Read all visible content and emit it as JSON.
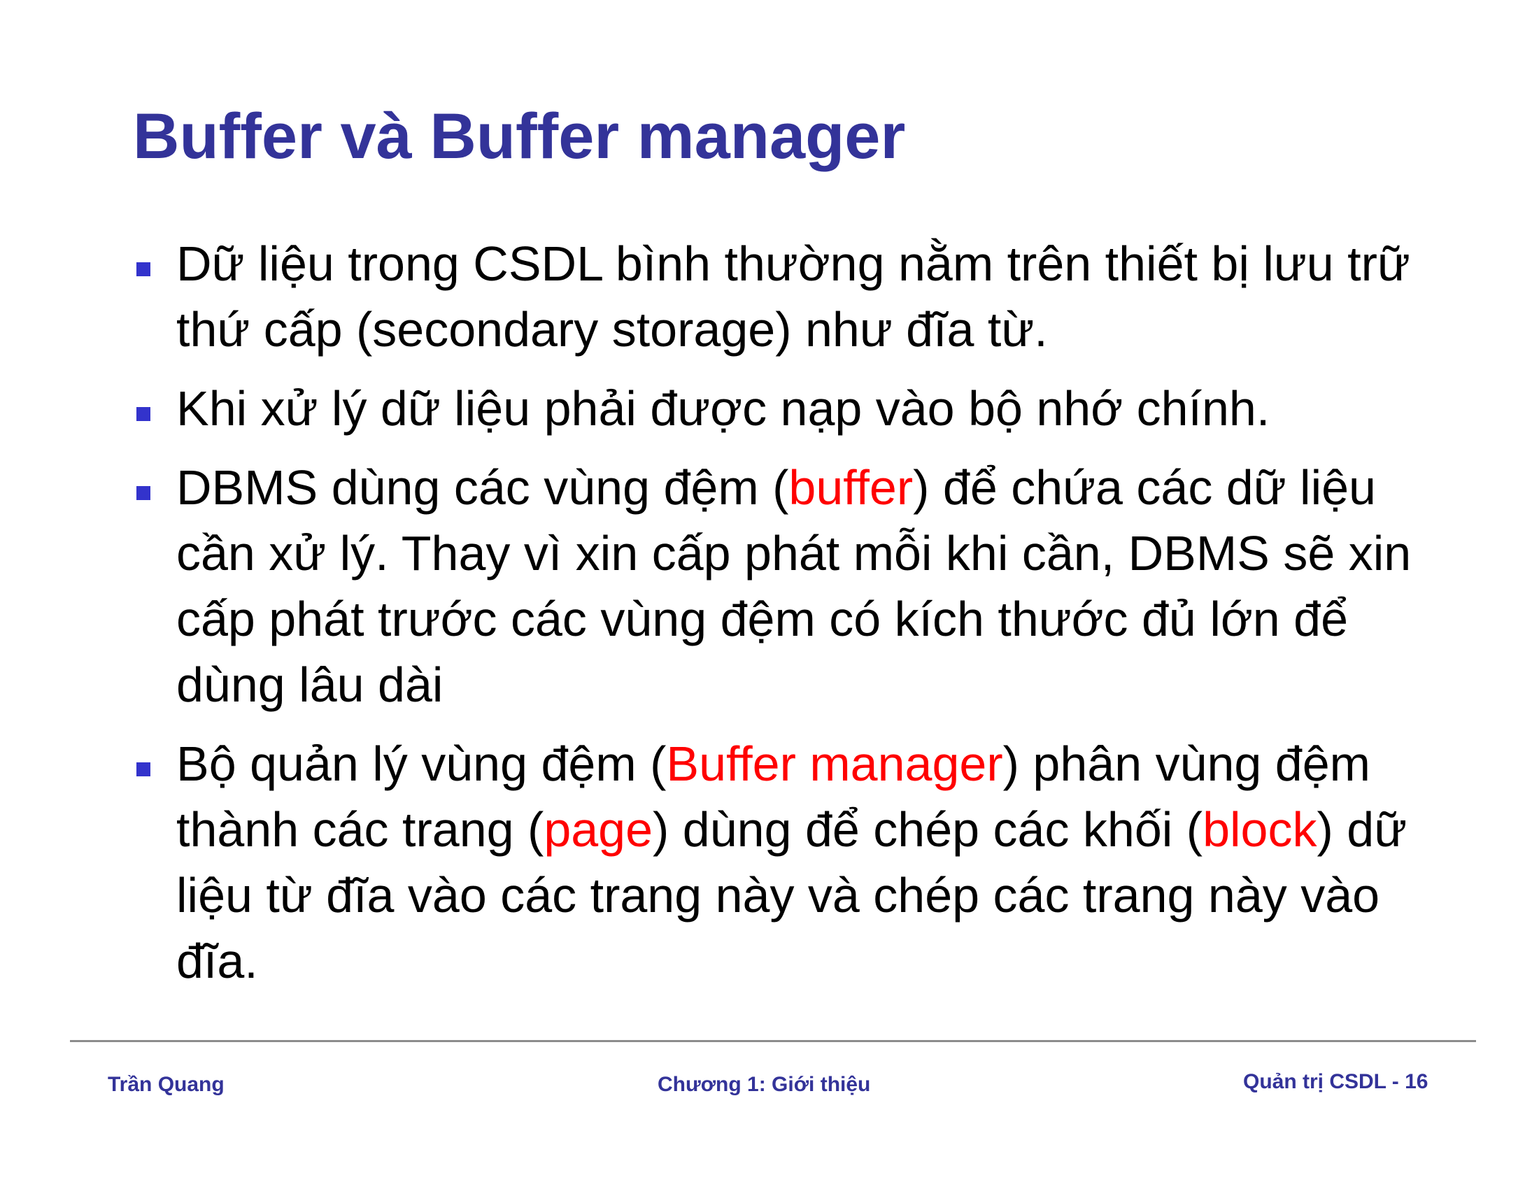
{
  "slide": {
    "title": "Buffer và Buffer manager",
    "accent_color": "#333399",
    "highlight_color": "#ff0000",
    "bullet_icon": "square-bullet-icon",
    "bullets": [
      {
        "segments": [
          {
            "text": "Dữ liệu trong CSDL bình thường nằm trên thiết bị lưu trữ thứ cấp (secondary storage) như đĩa từ."
          }
        ]
      },
      {
        "segments": [
          {
            "text": "Khi xử lý dữ liệu phải được nạp vào bộ nhớ chính."
          }
        ]
      },
      {
        "segments": [
          {
            "text": "DBMS dùng các vùng đệm ("
          },
          {
            "text": "buffer"
          },
          {
            "text": ") để chứa các dữ liệu cần xử lý. Thay vì xin cấp phát mỗi khi cần, DBMS sẽ xin cấp phát trước các vùng đệm có kích thước đủ lớn để dùng lâu dài"
          }
        ]
      },
      {
        "segments": [
          {
            "text": "Bộ quản lý vùng đệm ("
          },
          {
            "text": "Buffer manager"
          },
          {
            "text": ") phân vùng đệm thành các trang ("
          },
          {
            "text": "page"
          },
          {
            "text": ") dùng để chép các khối ("
          },
          {
            "text": "block"
          },
          {
            "text": ") dữ liệu từ đĩa vào các trang này và chép các trang này vào đĩa."
          }
        ]
      }
    ]
  },
  "footer": {
    "author": "Trần Quang",
    "chapter": "Chương 1: Giới thiệu",
    "page": "Quản trị CSDL - 16"
  }
}
